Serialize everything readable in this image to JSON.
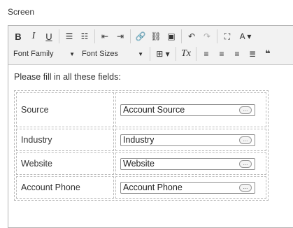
{
  "window": {
    "title": "Screen"
  },
  "toolbar": {
    "row1": [
      {
        "name": "bold-button",
        "glyph": "B"
      },
      {
        "name": "italic-button",
        "glyph": "I"
      },
      {
        "name": "underline-button",
        "glyph": "U"
      },
      {
        "name": "bullet-list-icon",
        "glyph": "☰"
      },
      {
        "name": "numbered-list-icon",
        "glyph": "☷"
      },
      {
        "name": "outdent-icon",
        "glyph": "⇤"
      },
      {
        "name": "indent-icon",
        "glyph": "⇥"
      },
      {
        "name": "link-icon",
        "glyph": "🔗"
      },
      {
        "name": "unlink-icon",
        "glyph": "⛓"
      },
      {
        "name": "image-icon",
        "glyph": "▣"
      },
      {
        "name": "undo-icon",
        "glyph": "↶"
      },
      {
        "name": "redo-icon",
        "glyph": "↷"
      },
      {
        "name": "fullscreen-icon",
        "glyph": "⛶"
      },
      {
        "name": "font-color-icon",
        "glyph": "A ▾"
      }
    ],
    "font_family_label": "Font Family",
    "font_sizes_label": "Font Sizes",
    "caret": "▼",
    "row2_icons": [
      {
        "name": "table-icon",
        "glyph": "⊞ ▾"
      },
      {
        "name": "clear-format-icon",
        "glyph": "Tx"
      },
      {
        "name": "align-left-icon",
        "glyph": "≡"
      },
      {
        "name": "align-center-icon",
        "glyph": "≡"
      },
      {
        "name": "align-right-icon",
        "glyph": "≡"
      },
      {
        "name": "justify-icon",
        "glyph": "≣"
      },
      {
        "name": "blockquote-icon",
        "glyph": "❝"
      }
    ]
  },
  "content": {
    "intro": "Please fill in all these fields:",
    "fields": [
      {
        "label": "Source",
        "value": "Account Source"
      },
      {
        "label": "Industry",
        "value": "Industry"
      },
      {
        "label": "Website",
        "value": "Website"
      },
      {
        "label": "Account Phone",
        "value": "Account Phone"
      }
    ],
    "lookup_glyph": "..."
  }
}
